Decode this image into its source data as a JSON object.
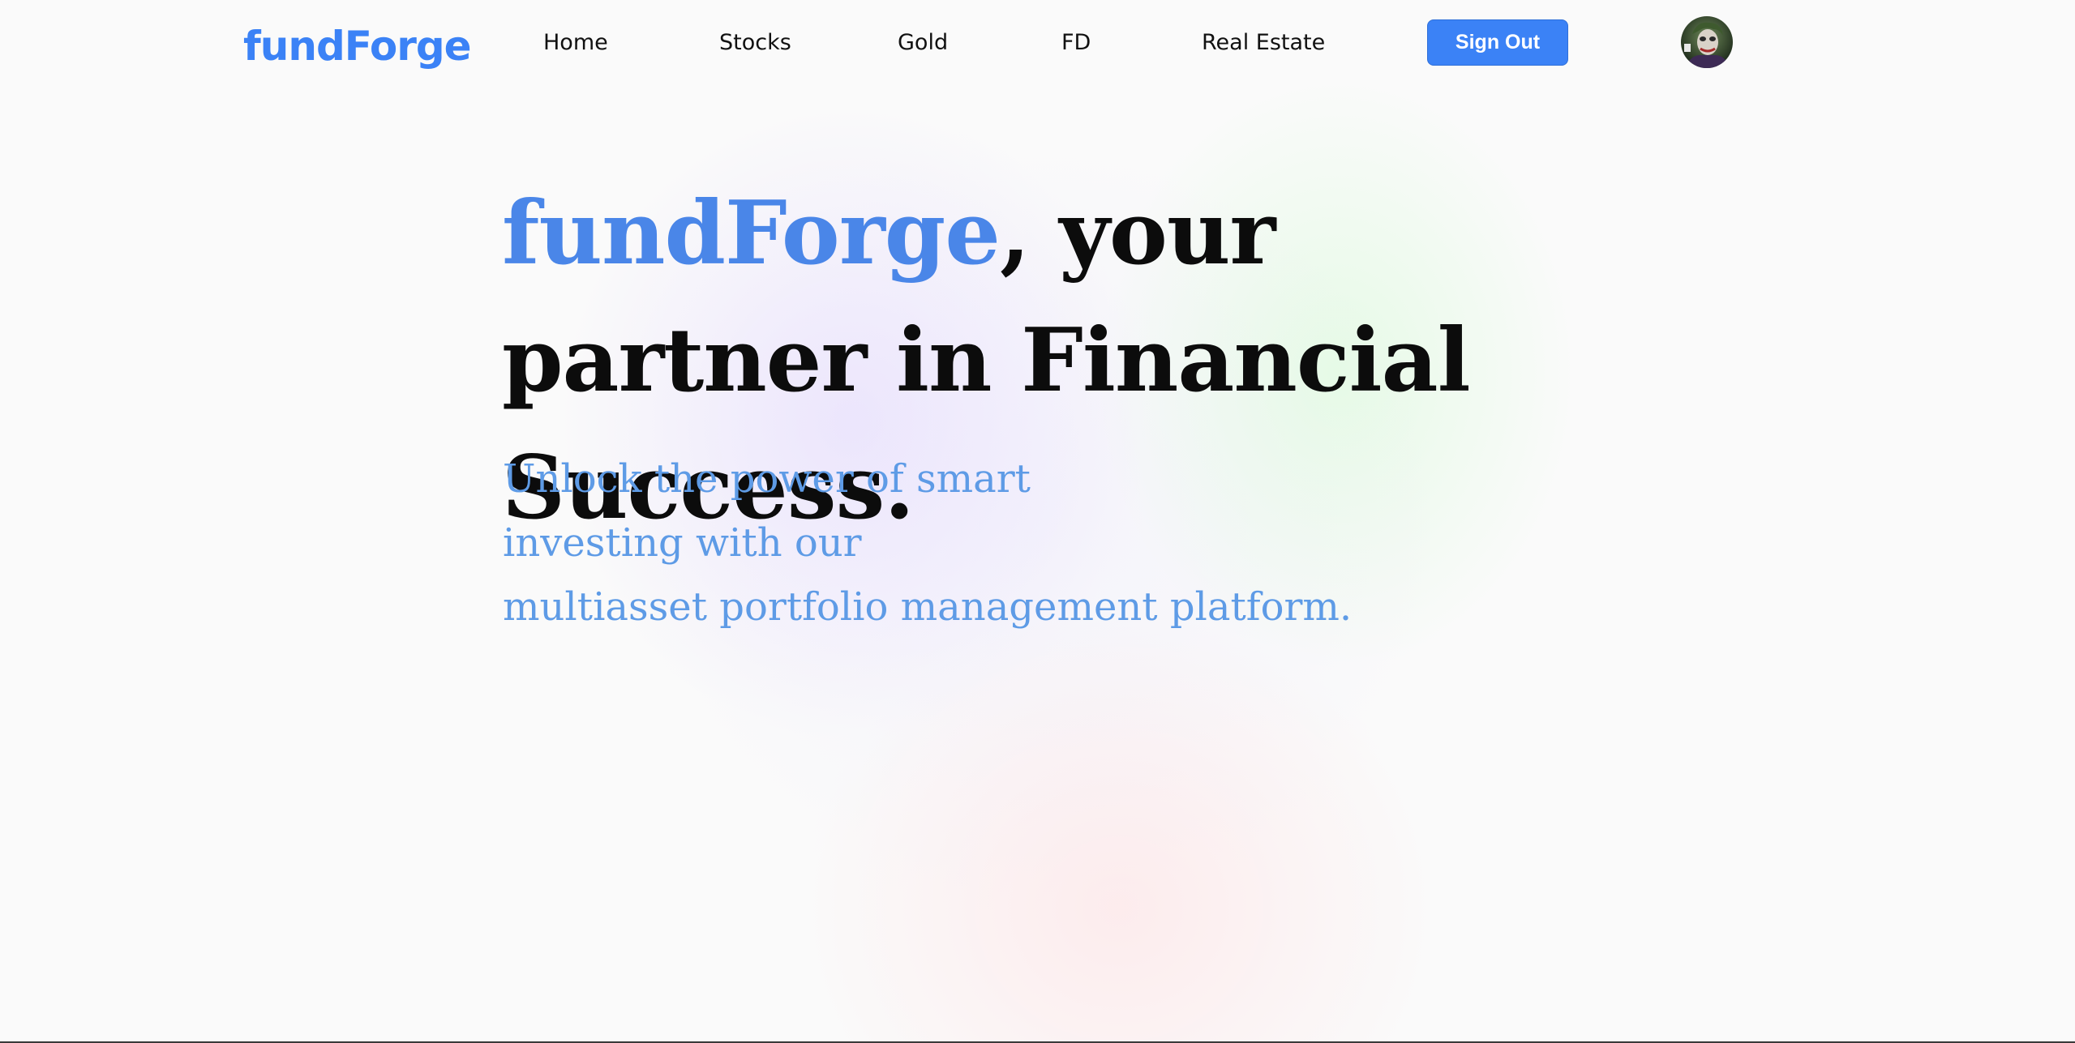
{
  "brand": {
    "logo_text": "fundForge",
    "accent_color": "#3b82f6"
  },
  "nav": {
    "items": [
      {
        "label": "Home"
      },
      {
        "label": "Stocks"
      },
      {
        "label": "Gold"
      },
      {
        "label": "FD"
      },
      {
        "label": "Real Estate"
      }
    ],
    "signout_label": "Sign Out",
    "avatar_icon": "user-avatar-icon"
  },
  "hero": {
    "title_brand": "fundForge",
    "title_rest": ", your partner in Financial Success.",
    "subtitle_lines": [
      "Unlock the power of smart",
      "investing with our",
      "multiasset portfolio management platform."
    ],
    "subtitle_color": "#5e9be6"
  }
}
